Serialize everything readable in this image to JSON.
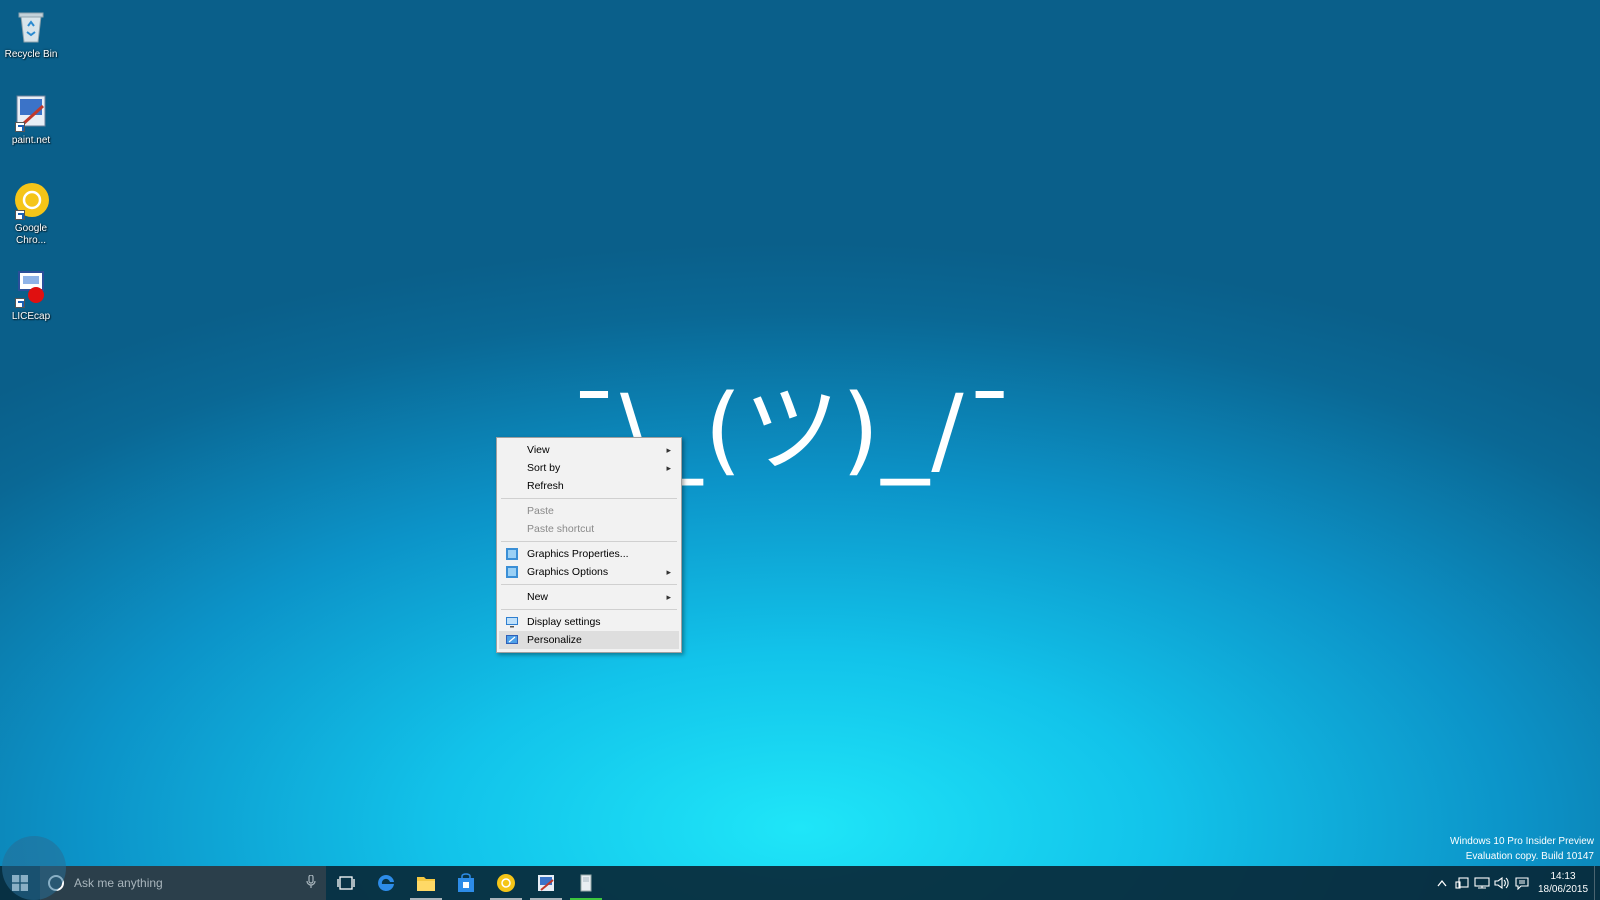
{
  "desktop": {
    "icons": [
      {
        "label": "Recycle Bin"
      },
      {
        "label": "paint.net"
      },
      {
        "label": "Google Chro..."
      },
      {
        "label": "LICEcap"
      }
    ],
    "wallpaper_text": "¯\\_(ツ)_/¯"
  },
  "context_menu": {
    "items": {
      "view": "View",
      "sort_by": "Sort by",
      "refresh": "Refresh",
      "paste": "Paste",
      "paste_shortcut": "Paste shortcut",
      "graphics_properties": "Graphics Properties...",
      "graphics_options": "Graphics Options",
      "new": "New",
      "display_settings": "Display settings",
      "personalize": "Personalize"
    },
    "highlighted": "personalize"
  },
  "watermark": {
    "line1": "Windows 10 Pro Insider Preview",
    "line2": "Evaluation copy. Build 10147"
  },
  "taskbar": {
    "search_placeholder": "Ask me anything",
    "clock": {
      "time": "14:13",
      "date": "18/06/2015"
    }
  },
  "colors": {
    "accent": "#0a6895",
    "taskbar": "#082838",
    "menu_bg": "#f2f2f2"
  }
}
